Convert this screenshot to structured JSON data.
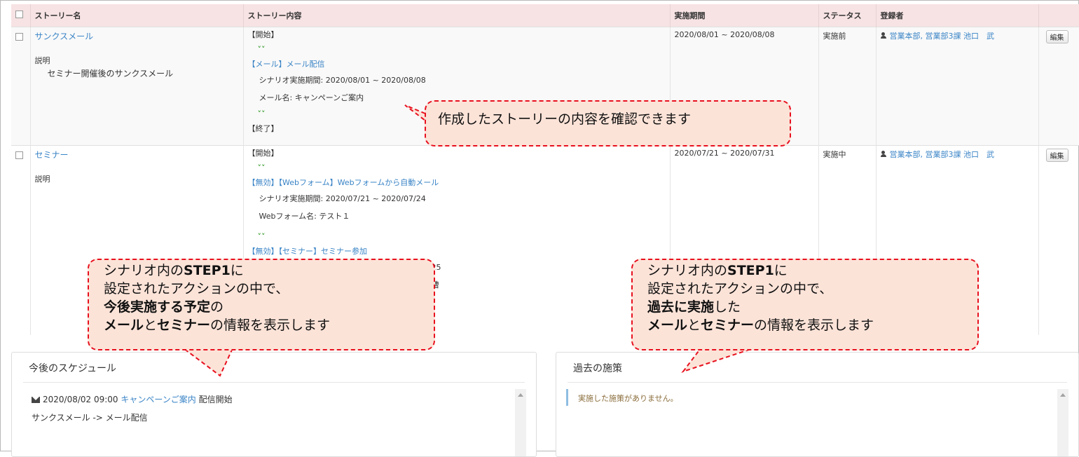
{
  "table": {
    "headers": {
      "name": "ストーリー名",
      "content": "ストーリー内容",
      "period": "実施期間",
      "status": "ステータス",
      "registrant": "登録者"
    },
    "edit_label": "編集",
    "rows": [
      {
        "name": "サンクスメール",
        "desc_label": "説明",
        "desc_text": "セミナー開催後のサンクスメール",
        "start": "【開始】",
        "action1": "【メール】メール配信",
        "action1_period": "シナリオ実施期間: 2020/08/01 ~ 2020/08/08",
        "action1_detail": "メール名: キャンペーンご案内",
        "end": "【終了】",
        "period": "2020/08/01 ~ 2020/08/08",
        "status": "実施前",
        "registrant": "営業本部, 営業部3課 池口　武"
      },
      {
        "name": "セミナー",
        "desc_label": "説明",
        "start": "【開始】",
        "action1": "【無効】【Webフォーム】Webフォームから自動メール",
        "action1_period": "シナリオ実施期間: 2020/07/21 ~ 2020/07/24",
        "action1_detail": "Webフォーム名: テスト１",
        "action2": "【無効】【セミナー】セミナー参加",
        "action2_partial": "25",
        "action2_partial2": "槽",
        "period": "2020/07/21 ~ 2020/07/31",
        "status": "実施中",
        "registrant": "営業本部, 営業部3課 池口　武"
      }
    ]
  },
  "schedule": {
    "title": "今後のスケジュール",
    "datetime": "2020/08/02 09:00",
    "mail_name": "キャンペーンご案内",
    "suffix": "配信開始",
    "path": "サンクスメール -> メール配信"
  },
  "past": {
    "title": "過去の施策",
    "empty_message": "実施した施策がありません。"
  },
  "callouts": {
    "top": "作成したストーリーの内容を確認できます",
    "left": {
      "l1a": "シナリオ内の",
      "l1b": "STEP1",
      "l1c": "に",
      "l2": "設定されたアクションの中で、",
      "l3a": "今後実施する予定",
      "l3b": "の",
      "l4a": "メール",
      "l4b": "と",
      "l4c": "セミナー",
      "l4d": "の情報を表示します"
    },
    "right": {
      "l1a": "シナリオ内の",
      "l1b": "STEP1",
      "l1c": "に",
      "l2": "設定されたアクションの中で、",
      "l3a": "過去に実施",
      "l3b": "した",
      "l4a": "メール",
      "l4b": "と",
      "l4c": "セミナー",
      "l4d": "の情報を表示します"
    }
  },
  "colors": {
    "header_bg": "#f7e3e4",
    "link": "#3a84c6",
    "callout_bg": "#fce3d8",
    "callout_border": "#e8101e",
    "arrow": "#3ea034"
  }
}
